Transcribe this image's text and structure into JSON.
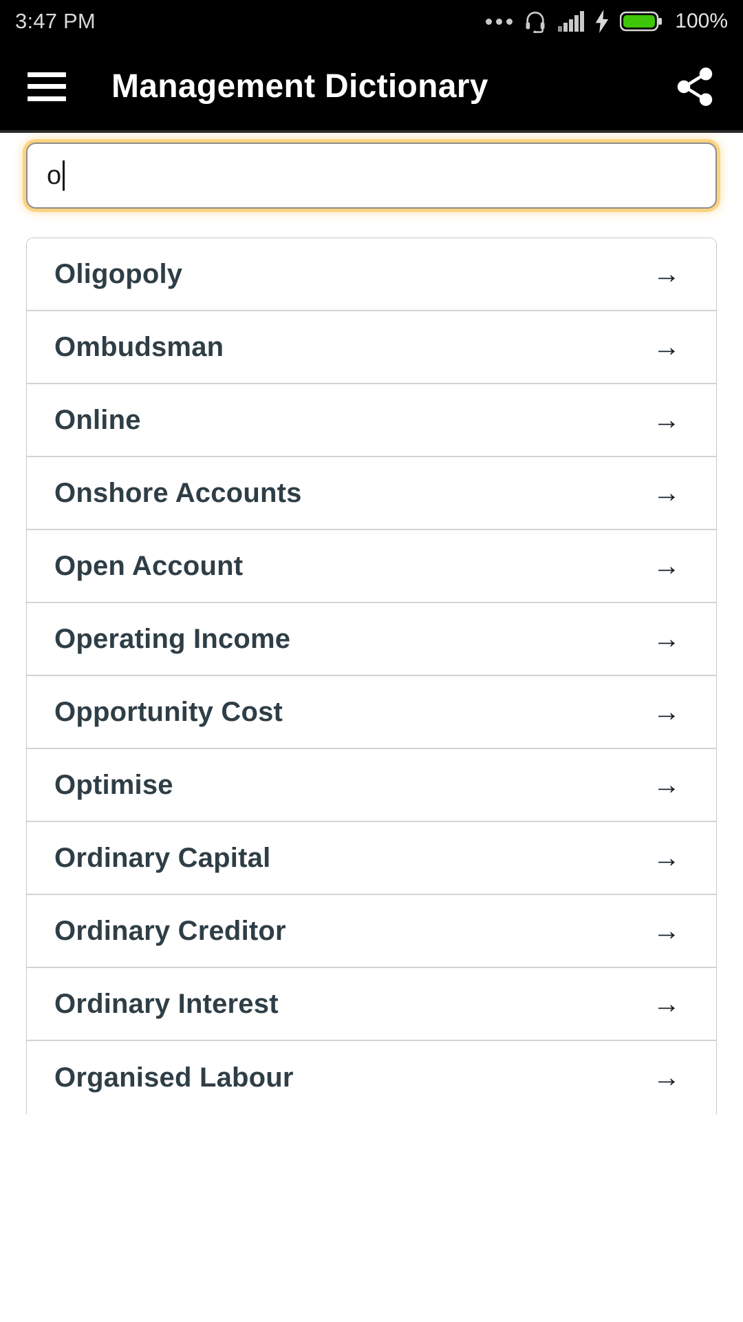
{
  "status_bar": {
    "time": "3:47 PM",
    "battery_percent": "100%",
    "icons": [
      "more-dots-icon",
      "headset-icon",
      "signal-bars-icon",
      "charging-bolt-icon",
      "battery-icon"
    ],
    "battery_color": "#3ec60a",
    "background": "#000000",
    "text_color": "#d8d8d8"
  },
  "app_bar": {
    "menu_icon": "hamburger-menu-icon",
    "title": "Management Dictionary",
    "share_icon": "share-icon",
    "background": "#000000",
    "text_color": "#ffffff"
  },
  "search": {
    "value": "o",
    "placeholder": "",
    "focus_glow_color": "#fabe46",
    "border_color": "#8d8d8d"
  },
  "results": {
    "text_color": "#2f3e46",
    "arrow_glyph": "→",
    "items": [
      {
        "label": "Oligopoly"
      },
      {
        "label": "Ombudsman"
      },
      {
        "label": "Online"
      },
      {
        "label": "Onshore Accounts"
      },
      {
        "label": "Open Account"
      },
      {
        "label": "Operating Income"
      },
      {
        "label": "Opportunity Cost"
      },
      {
        "label": "Optimise"
      },
      {
        "label": "Ordinary Capital"
      },
      {
        "label": "Ordinary Creditor"
      },
      {
        "label": "Ordinary Interest"
      },
      {
        "label": "Organised Labour"
      }
    ]
  }
}
